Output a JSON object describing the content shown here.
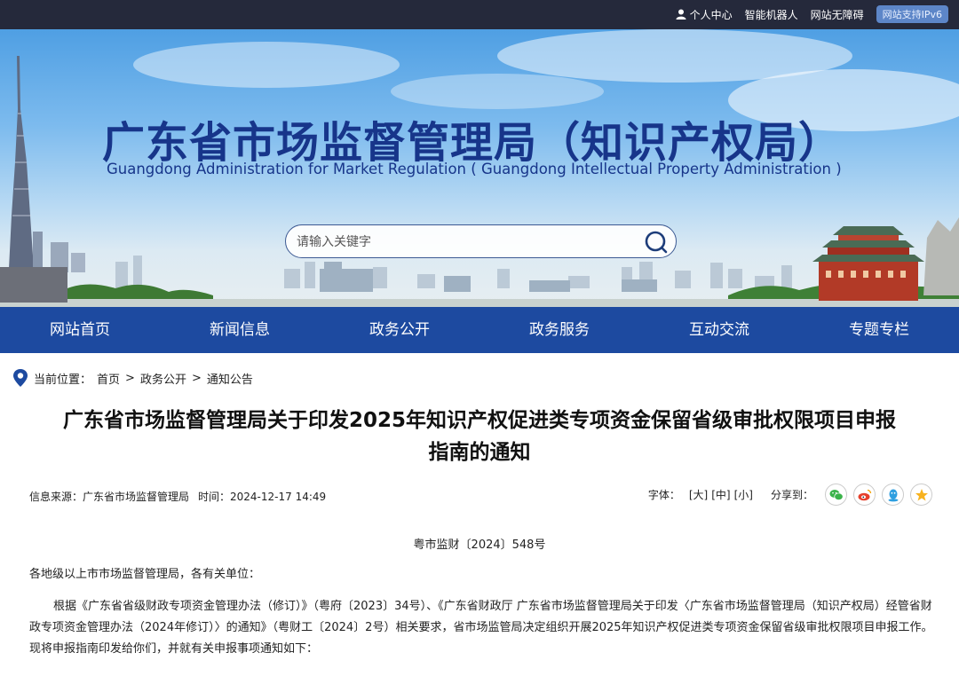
{
  "topbar": {
    "personal_center": "个人中心",
    "robot": "智能机器人",
    "accessible": "网站无障碍",
    "ipv6": "网站支持IPv6"
  },
  "banner": {
    "title_cn": "广东省市场监督管理局（知识产权局）",
    "title_en": "Guangdong Administration for Market Regulation ( Guangdong Intellectual Property Administration )",
    "search_placeholder": "请输入关键字"
  },
  "nav": {
    "items": [
      {
        "label": "网站首页"
      },
      {
        "label": "新闻信息"
      },
      {
        "label": "政务公开"
      },
      {
        "label": "政务服务"
      },
      {
        "label": "互动交流"
      },
      {
        "label": "专题专栏"
      }
    ]
  },
  "breadcrumb": {
    "prefix": "当前位置：",
    "items": [
      "首页",
      "政务公开",
      "通知公告"
    ],
    "sep": ">"
  },
  "article": {
    "title_line1": "广东省市场监督管理局关于印发2025年知识产权促进类专项资金保留省级审批权限项目申报",
    "title_line2": "指南的通知",
    "source": "信息来源：广东省市场监督管理局",
    "time": "时间：2024-12-17 14:49",
    "font_label": "字体：",
    "font_sizes": [
      "[大]",
      "[中]",
      "[小]"
    ],
    "share_label": "分享到：",
    "share_icons": [
      "wechat-icon",
      "weibo-icon",
      "qq-icon",
      "qzone-icon"
    ],
    "doc_number": "粤市监财〔2024〕548号",
    "salutation": "各地级以上市市场监督管理局，各有关单位：",
    "body": "根据《广东省省级财政专项资金管理办法（修订）》（粤府〔2023〕34号）、《广东省财政厅 广东省市场监督管理局关于印发〈广东省市场监督管理局（知识产权局）经管省财政专项资金管理办法（2024年修订）〉的通知》（粤财工〔2024〕2号）相关要求，省市场监管局决定组织开展2025年知识产权促进类专项资金保留省级审批权限项目申报工作。现将申报指南印发给你们，并就有关申报事项通知如下："
  },
  "colors": {
    "topbar": "#25293b",
    "nav": "#1d4aa0",
    "title": "#17358a"
  }
}
